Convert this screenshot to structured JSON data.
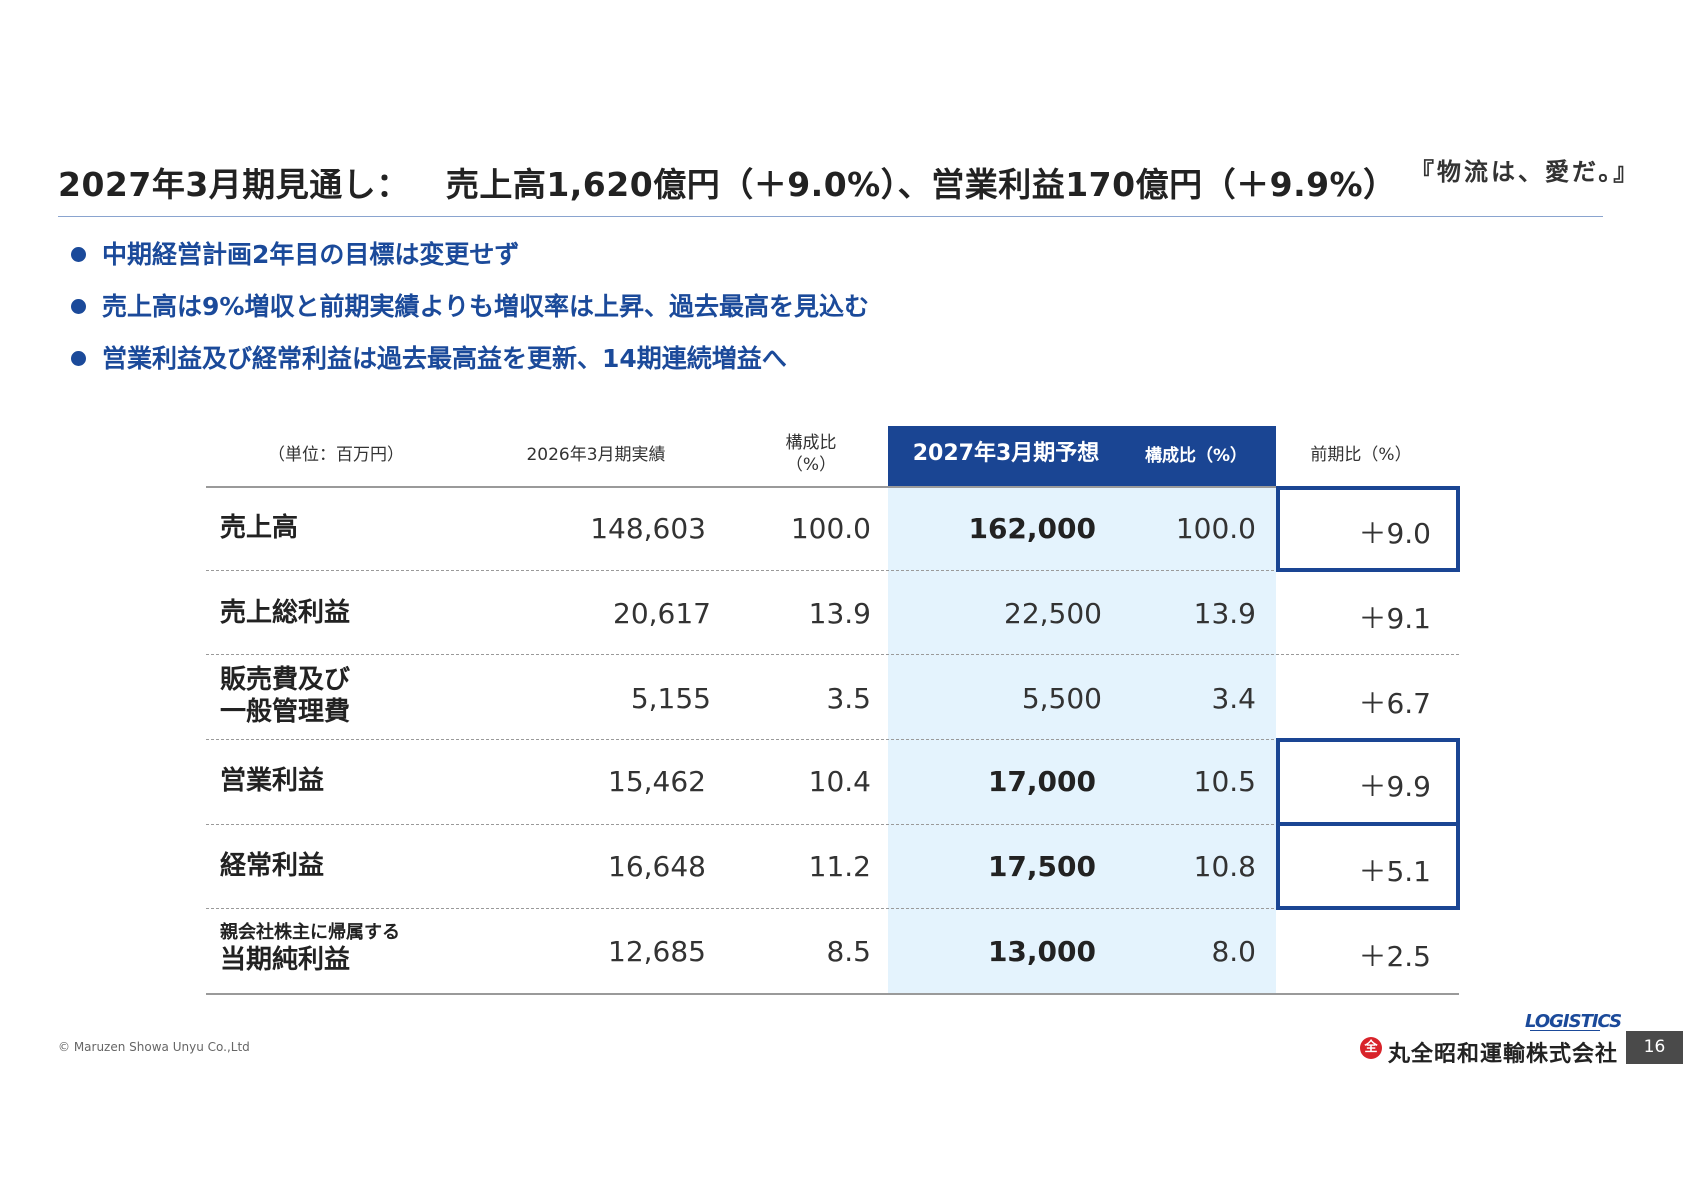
{
  "header": {
    "title_part1": "2027年3月期見通し：",
    "title_part2": "売上高1,620億円（＋9.0%）、営業利益170億円（＋9.9%）",
    "slogan": "『物流は、愛だ。』"
  },
  "bullets": [
    "中期経営計画2年目の目標は変更せず",
    "売上高は9%増収と前期実績よりも増収率は上昇、過去最高を見込む",
    "営業利益及び経常利益は過去最高益を更新、14期連続増益へ"
  ],
  "table": {
    "headers": {
      "unit": "（単位：百万円）",
      "actual": "2026年3月期実績",
      "ratio_line1": "構成比",
      "ratio_line2": "（%）",
      "forecast": "2027年3月期予想",
      "forecast_ratio": "構成比（%）",
      "yoy": "前期比（%）"
    },
    "rows": [
      {
        "label": "売上高",
        "label_sub": "",
        "actual": "148,603",
        "ratio": "100.0",
        "forecast": "162,000",
        "forecast_ratio": "100.0",
        "yoy": "＋9.0",
        "bold": true,
        "boxed": true
      },
      {
        "label": "売上総利益",
        "label_sub": "",
        "actual": "20,617",
        "ratio": "13.9",
        "forecast": "22,500",
        "forecast_ratio": "13.9",
        "yoy": "＋9.1",
        "bold": false,
        "boxed": false
      },
      {
        "label": "販売費及び",
        "label_sub": "一般管理費",
        "actual": "5,155",
        "ratio": "3.5",
        "forecast": "5,500",
        "forecast_ratio": "3.4",
        "yoy": "＋6.7",
        "bold": false,
        "boxed": false
      },
      {
        "label": "営業利益",
        "label_sub": "",
        "actual": "15,462",
        "ratio": "10.4",
        "forecast": "17,000",
        "forecast_ratio": "10.5",
        "yoy": "＋9.9",
        "bold": true,
        "boxed": true
      },
      {
        "label": "経常利益",
        "label_sub": "",
        "actual": "16,648",
        "ratio": "11.2",
        "forecast": "17,500",
        "forecast_ratio": "10.8",
        "yoy": "＋5.1",
        "bold": true,
        "boxed": true
      },
      {
        "label": "親会社株主に帰属する",
        "label_sub": "当期純利益",
        "actual": "12,685",
        "ratio": "8.5",
        "forecast": "13,000",
        "forecast_ratio": "8.0",
        "yoy": "＋2.5",
        "bold": true,
        "boxed": false
      }
    ]
  },
  "footer": {
    "copyright": "© Maruzen Showa Unyu Co.,Ltd",
    "logo_text": "LOGISTICS",
    "company": "丸全昭和運輸株式会社",
    "company_mark": "全",
    "page": "16"
  },
  "colors": {
    "navy": "#1a4593",
    "bullet_blue": "#1b4a9a",
    "highlight_bg": "#e4f3fd"
  }
}
